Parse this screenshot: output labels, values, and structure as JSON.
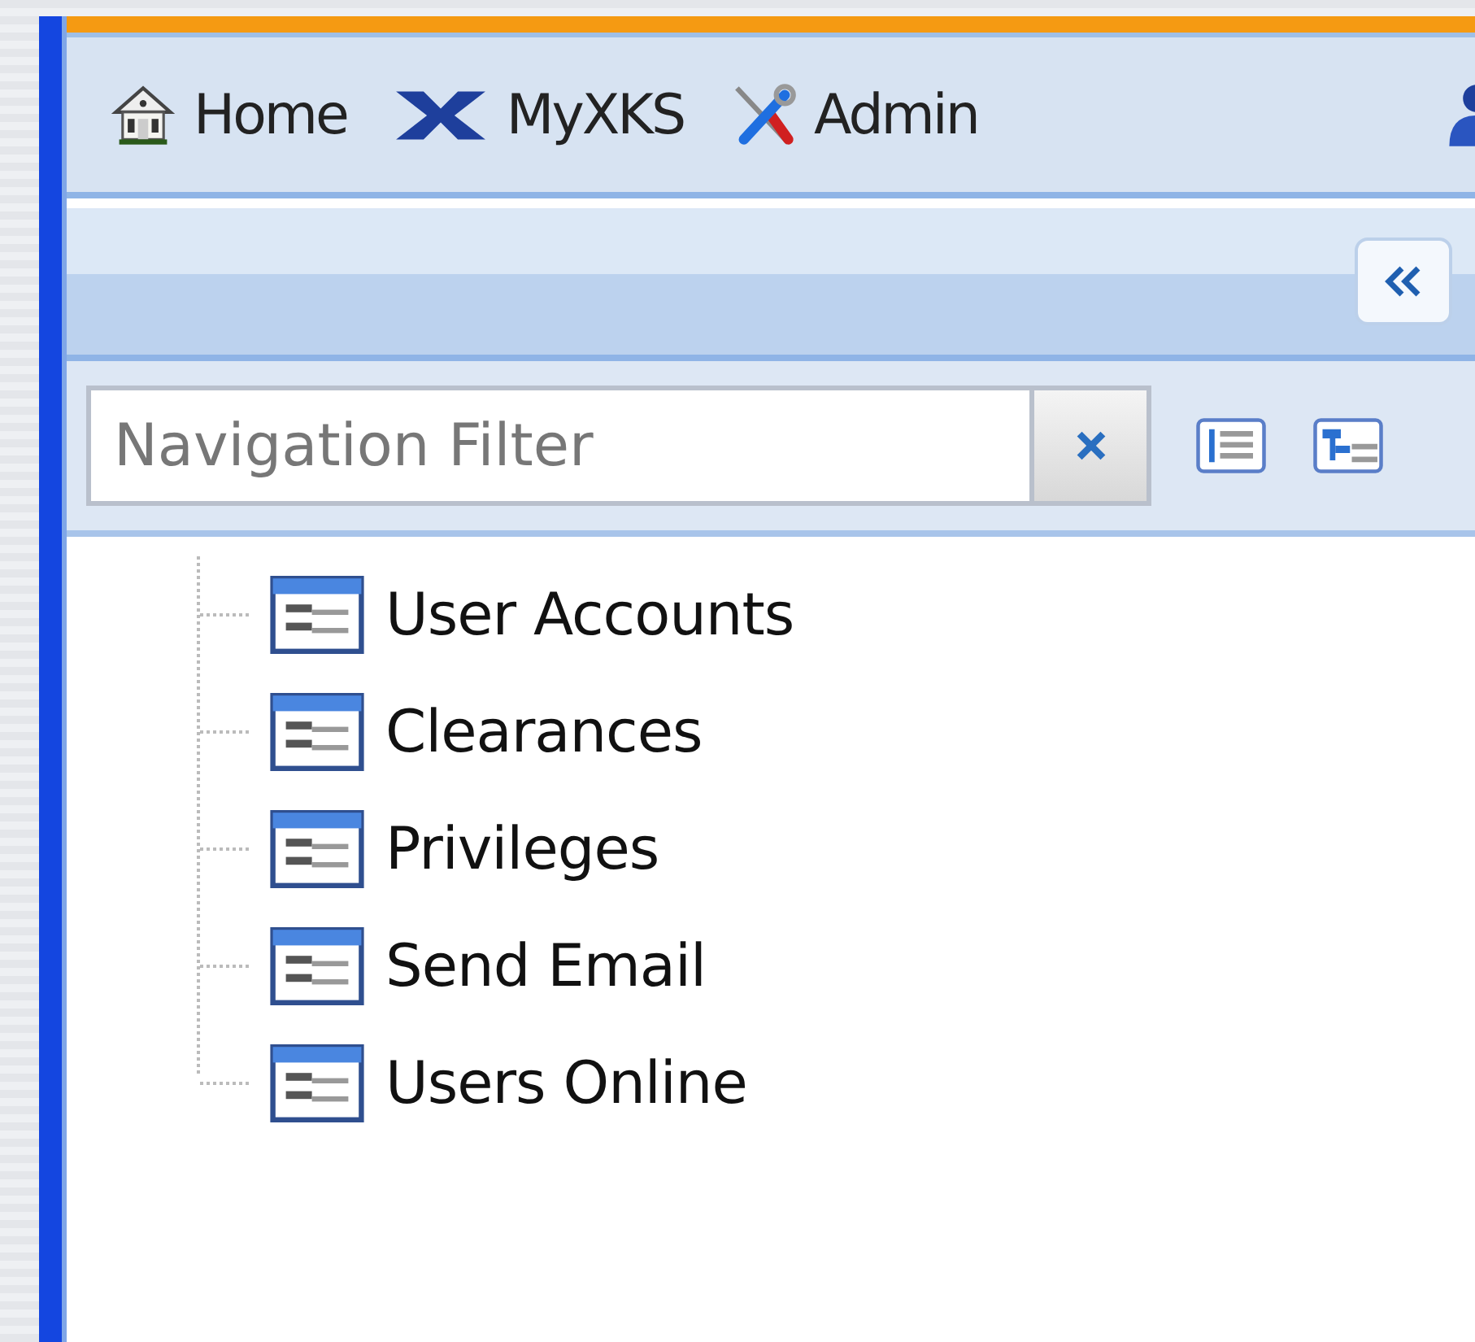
{
  "toolbar": {
    "items": [
      {
        "kind": "home",
        "label": "Home"
      },
      {
        "kind": "xks",
        "label": "MyXKS"
      },
      {
        "kind": "admin",
        "label": "Admin"
      }
    ]
  },
  "filter": {
    "placeholder": "Navigation Filter"
  },
  "tree": {
    "items": [
      {
        "label": "User Accounts"
      },
      {
        "label": "Clearances"
      },
      {
        "label": "Privileges"
      },
      {
        "label": "Send Email"
      },
      {
        "label": "Users Online"
      }
    ]
  }
}
